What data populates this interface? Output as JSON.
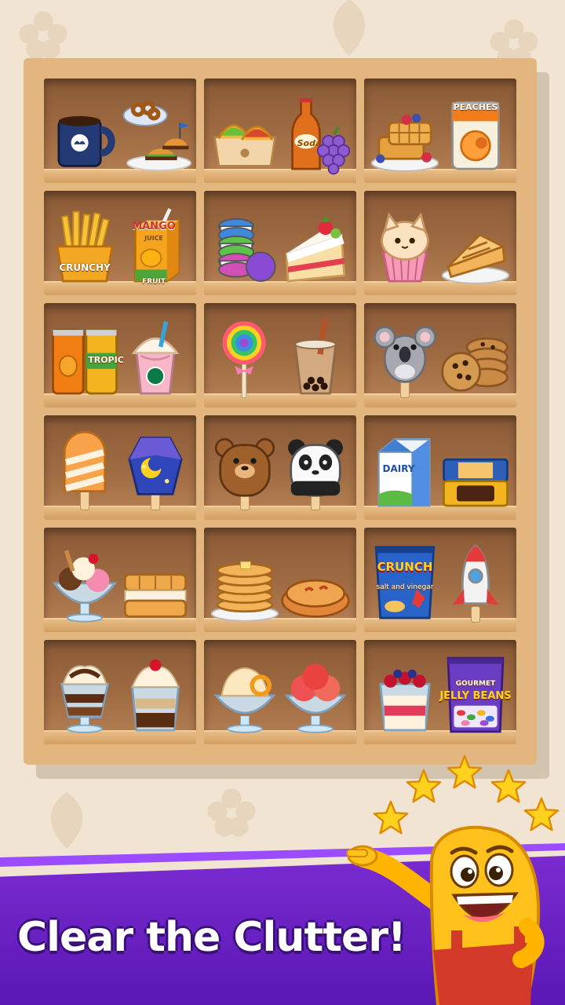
{
  "headline": "Clear the Clutter!",
  "colors": {
    "banner": "#6a22c4",
    "shelf_wood": "#e2b67e",
    "cell_back": "#9a6640",
    "mascot_yellow": "#ffc21c",
    "star_gold": "#ffd21f"
  },
  "shelf": {
    "rows": [
      [
        {
          "left": {
            "name": "coffee-mug-icon"
          },
          "right": {
            "name": "pretzel-burger-plate-icon"
          }
        },
        {
          "left": {
            "name": "tacos-icon"
          },
          "right": {
            "name": "soda-bottle-grapes-icon",
            "label": "Soda"
          }
        },
        {
          "left": {
            "name": "waffles-icon"
          },
          "right": {
            "name": "peaches-can-icon",
            "label": "PEACHES"
          }
        }
      ],
      [
        {
          "left": {
            "name": "fries-icon",
            "label": "CRUNCHY"
          },
          "right": {
            "name": "juice-box-icon",
            "label": "MANGO",
            "sublabel": "JUICE",
            "footer": "FRUIT"
          }
        },
        {
          "left": {
            "name": "macarons-icon"
          },
          "right": {
            "name": "cake-slice-icon"
          }
        },
        {
          "left": {
            "name": "cat-cupcake-icon"
          },
          "right": {
            "name": "pie-slice-icon"
          }
        }
      ],
      [
        {
          "left": {
            "name": "soda-cans-icon",
            "label": "TROPIC"
          },
          "right": {
            "name": "frappe-cup-icon"
          }
        },
        {
          "left": {
            "name": "lollipop-icon"
          },
          "right": {
            "name": "bubble-tea-icon"
          }
        },
        {
          "left": {
            "name": "koala-popsicle-icon"
          },
          "right": {
            "name": "cookies-icon"
          }
        }
      ],
      [
        {
          "left": {
            "name": "creamsicle-icon"
          },
          "right": {
            "name": "night-popsicle-icon"
          }
        },
        {
          "left": {
            "name": "bear-popsicle-icon"
          },
          "right": {
            "name": "panda-popsicle-icon"
          }
        },
        {
          "left": {
            "name": "milk-carton-icon",
            "label": "DAIRY"
          },
          "right": {
            "name": "snack-bars-icon"
          }
        }
      ],
      [
        {
          "left": {
            "name": "sundae-icon"
          },
          "right": {
            "name": "ice-cream-sandwich-icon"
          }
        },
        {
          "left": {
            "name": "pancakes-icon"
          },
          "right": {
            "name": "pie-icon"
          }
        },
        {
          "left": {
            "name": "chips-bag-icon",
            "label": "CRUNCH",
            "sublabel": "salt and vinegar"
          },
          "right": {
            "name": "rocket-popsicle-icon"
          }
        }
      ],
      [
        {
          "left": {
            "name": "chocolate-parfait-icon"
          },
          "right": {
            "name": "cherry-parfait-icon"
          }
        },
        {
          "left": {
            "name": "orange-sorbet-icon"
          },
          "right": {
            "name": "strawberry-sorbet-icon"
          }
        },
        {
          "left": {
            "name": "berry-parfait-icon"
          },
          "right": {
            "name": "jelly-beans-bag-icon",
            "label": "GOURMET",
            "sublabel": "JELLY BEANS"
          }
        }
      ]
    ]
  },
  "stars_count": 5
}
